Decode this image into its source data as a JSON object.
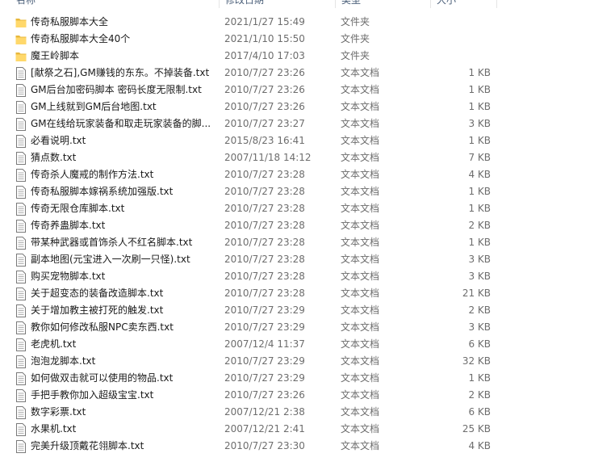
{
  "header": {
    "name_label": "名称",
    "date_label": "修改日期",
    "type_label": "类型",
    "size_label": "大小"
  },
  "colors": {
    "folder": "#ffd86b",
    "folder_dark": "#e8b83c",
    "doc_border": "#7a7a7a",
    "hover": "#e5f3ff"
  },
  "files": [
    {
      "name": "传奇私服脚本大全",
      "date": "2021/1/27 15:49",
      "type": "文件夹",
      "size": "",
      "icon": "folder-icon"
    },
    {
      "name": "传奇私服脚本大全40个",
      "date": "2021/1/10 15:50",
      "type": "文件夹",
      "size": "",
      "icon": "folder-icon"
    },
    {
      "name": "魔王岭脚本",
      "date": "2017/4/10 17:03",
      "type": "文件夹",
      "size": "",
      "icon": "folder-icon"
    },
    {
      "name": "[献祭之石],GM赚钱的东东。不掉装备.txt",
      "date": "2010/7/27 23:26",
      "type": "文本文档",
      "size": "1 KB",
      "icon": "text-file-icon"
    },
    {
      "name": "GM后台加密码脚本 密码长度无限制.txt",
      "date": "2010/7/27 23:26",
      "type": "文本文档",
      "size": "1 KB",
      "icon": "text-file-icon"
    },
    {
      "name": "GM上线就到GM后台地图.txt",
      "date": "2010/7/27 23:26",
      "type": "文本文档",
      "size": "1 KB",
      "icon": "text-file-icon"
    },
    {
      "name": "GM在线给玩家装备和取走玩家装备的脚...",
      "date": "2010/7/27 23:27",
      "type": "文本文档",
      "size": "3 KB",
      "icon": "text-file-icon"
    },
    {
      "name": "必看说明.txt",
      "date": "2015/8/23 16:41",
      "type": "文本文档",
      "size": "1 KB",
      "icon": "text-file-icon"
    },
    {
      "name": "猜点数.txt",
      "date": "2007/11/18 14:12",
      "type": "文本文档",
      "size": "7 KB",
      "icon": "text-file-icon"
    },
    {
      "name": "传奇杀人魔戒的制作方法.txt",
      "date": "2010/7/27 23:28",
      "type": "文本文档",
      "size": "4 KB",
      "icon": "text-file-icon"
    },
    {
      "name": "传奇私服脚本嫁祸系统加强版.txt",
      "date": "2010/7/27 23:28",
      "type": "文本文档",
      "size": "1 KB",
      "icon": "text-file-icon"
    },
    {
      "name": "传奇无限仓库脚本.txt",
      "date": "2010/7/27 23:28",
      "type": "文本文档",
      "size": "1 KB",
      "icon": "text-file-icon"
    },
    {
      "name": "传奇养蛊脚本.txt",
      "date": "2010/7/27 23:28",
      "type": "文本文档",
      "size": "2 KB",
      "icon": "text-file-icon"
    },
    {
      "name": "带某种武器或首饰杀人不红名脚本.txt",
      "date": "2010/7/27 23:28",
      "type": "文本文档",
      "size": "1 KB",
      "icon": "text-file-icon"
    },
    {
      "name": "副本地图(元宝进入一次刷一只怪).txt",
      "date": "2010/7/27 23:28",
      "type": "文本文档",
      "size": "3 KB",
      "icon": "text-file-icon"
    },
    {
      "name": "购买宠物脚本.txt",
      "date": "2010/7/27 23:28",
      "type": "文本文档",
      "size": "3 KB",
      "icon": "text-file-icon"
    },
    {
      "name": "关于超变态的装备改造脚本.txt",
      "date": "2010/7/27 23:28",
      "type": "文本文档",
      "size": "21 KB",
      "icon": "text-file-icon"
    },
    {
      "name": "关于增加教主被打死的触发.txt",
      "date": "2010/7/27 23:29",
      "type": "文本文档",
      "size": "2 KB",
      "icon": "text-file-icon"
    },
    {
      "name": "教你如何修改私服NPC卖东西.txt",
      "date": "2010/7/27 23:29",
      "type": "文本文档",
      "size": "3 KB",
      "icon": "text-file-icon"
    },
    {
      "name": "老虎机.txt",
      "date": "2007/12/4 11:37",
      "type": "文本文档",
      "size": "6 KB",
      "icon": "text-file-icon"
    },
    {
      "name": "泡泡龙脚本.txt",
      "date": "2010/7/27 23:29",
      "type": "文本文档",
      "size": "32 KB",
      "icon": "text-file-icon"
    },
    {
      "name": "如何做双击就可以使用的物品.txt",
      "date": "2010/7/27 23:29",
      "type": "文本文档",
      "size": "1 KB",
      "icon": "text-file-icon"
    },
    {
      "name": "手把手教你加入超级宝宝.txt",
      "date": "2010/7/27 23:26",
      "type": "文本文档",
      "size": "2 KB",
      "icon": "text-file-icon"
    },
    {
      "name": "数字彩票.txt",
      "date": "2007/12/21 2:38",
      "type": "文本文档",
      "size": "6 KB",
      "icon": "text-file-icon"
    },
    {
      "name": "水果机.txt",
      "date": "2007/12/21 2:41",
      "type": "文本文档",
      "size": "25 KB",
      "icon": "text-file-icon"
    },
    {
      "name": "完美升级顶戴花翎脚本.txt",
      "date": "2010/7/27 23:30",
      "type": "文本文档",
      "size": "4 KB",
      "icon": "text-file-icon"
    }
  ]
}
